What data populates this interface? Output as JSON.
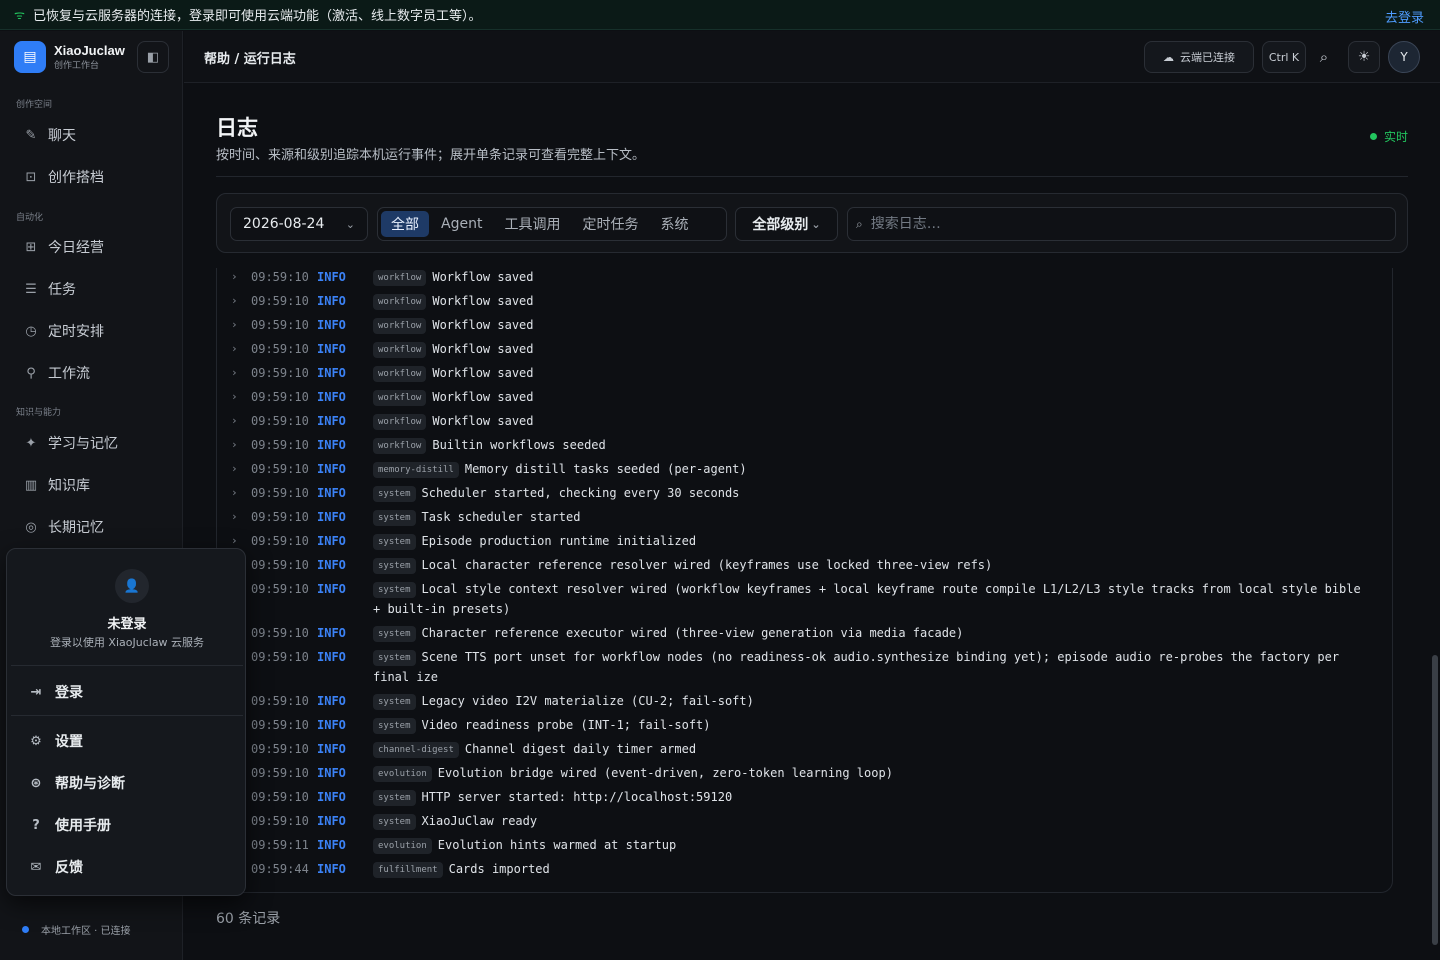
{
  "banner": {
    "text": "已恢复与云服务器的连接，登录即可使用云端功能（激活、线上数字员工等）。",
    "link": "去登录"
  },
  "brand": {
    "name": "XiaoJuclaw",
    "subtitle": "创作工作台"
  },
  "sidebar": {
    "sections": [
      "创作空间",
      "自动化",
      "知识与能力"
    ],
    "items": [
      {
        "label": "聊天",
        "icon": "✎"
      },
      {
        "label": "创作搭档",
        "icon": "⊡"
      },
      {
        "label": "今日经营",
        "icon": "⊞"
      },
      {
        "label": "任务",
        "icon": "☰"
      },
      {
        "label": "定时安排",
        "icon": "◷"
      },
      {
        "label": "工作流",
        "icon": "⚲"
      },
      {
        "label": "学习与记忆",
        "icon": "✦"
      },
      {
        "label": "知识库",
        "icon": "▥"
      },
      {
        "label": "长期记忆",
        "icon": "◎"
      }
    ],
    "status": "本地工作区 · 已连接"
  },
  "topbar": {
    "breadcrumb": "帮助 / 运行日志",
    "cloud": "云端已连接",
    "shortcut": "Ctrl K",
    "avatar": "Y"
  },
  "page": {
    "title": "日志",
    "subtitle": "按时间、来源和级别追踪本机运行事件；展开单条记录可查看完整上下文。",
    "live": "实时",
    "date": "2026-08-24",
    "tabs": [
      "全部",
      "Agent",
      "工具调用",
      "定时任务",
      "系统"
    ],
    "level": "全部级别",
    "search_placeholder": "搜索日志…",
    "count": "60 条记录"
  },
  "logs": [
    {
      "time": "09:59:10",
      "level": "INFO",
      "source": "workflow",
      "msg": "Workflow saved"
    },
    {
      "time": "09:59:10",
      "level": "INFO",
      "source": "workflow",
      "msg": "Workflow saved"
    },
    {
      "time": "09:59:10",
      "level": "INFO",
      "source": "workflow",
      "msg": "Workflow saved"
    },
    {
      "time": "09:59:10",
      "level": "INFO",
      "source": "workflow",
      "msg": "Workflow saved"
    },
    {
      "time": "09:59:10",
      "level": "INFO",
      "source": "workflow",
      "msg": "Workflow saved"
    },
    {
      "time": "09:59:10",
      "level": "INFO",
      "source": "workflow",
      "msg": "Workflow saved"
    },
    {
      "time": "09:59:10",
      "level": "INFO",
      "source": "workflow",
      "msg": "Workflow saved"
    },
    {
      "time": "09:59:10",
      "level": "INFO",
      "source": "workflow",
      "msg": "Builtin workflows seeded"
    },
    {
      "time": "09:59:10",
      "level": "INFO",
      "source": "memory-distill",
      "msg": "Memory distill tasks seeded (per-agent)"
    },
    {
      "time": "09:59:10",
      "level": "INFO",
      "source": "system",
      "msg": "Scheduler started, checking every 30 seconds"
    },
    {
      "time": "09:59:10",
      "level": "INFO",
      "source": "system",
      "msg": "Task scheduler started"
    },
    {
      "time": "09:59:10",
      "level": "INFO",
      "source": "system",
      "msg": "Episode production runtime initialized"
    },
    {
      "time": "09:59:10",
      "level": "INFO",
      "source": "system",
      "msg": "Local character reference resolver wired (keyframes use locked three-view refs)"
    },
    {
      "time": "09:59:10",
      "level": "INFO",
      "source": "system",
      "msg": "Local style context resolver wired (workflow keyframes + local keyframe route compile L1/L2/L3 style tracks from local style bible + built-in presets)"
    },
    {
      "time": "09:59:10",
      "level": "INFO",
      "source": "system",
      "msg": "Character reference executor wired (three-view generation via media facade)"
    },
    {
      "time": "09:59:10",
      "level": "INFO",
      "source": "system",
      "msg": "Scene TTS port unset for workflow nodes (no readiness-ok audio.synthesize binding yet); episode audio re-probes the factory per final ize"
    },
    {
      "time": "09:59:10",
      "level": "INFO",
      "source": "system",
      "msg": "Legacy video I2V materialize (CU-2; fail-soft)"
    },
    {
      "time": "09:59:10",
      "level": "INFO",
      "source": "system",
      "msg": "Video readiness probe (INT-1; fail-soft)"
    },
    {
      "time": "09:59:10",
      "level": "INFO",
      "source": "channel-digest",
      "msg": "Channel digest daily timer armed"
    },
    {
      "time": "09:59:10",
      "level": "INFO",
      "source": "evolution",
      "msg": "Evolution bridge wired (event-driven, zero-token learning loop)"
    },
    {
      "time": "09:59:10",
      "level": "INFO",
      "source": "system",
      "msg": "HTTP server started: http://localhost:59120"
    },
    {
      "time": "09:59:10",
      "level": "INFO",
      "source": "system",
      "msg": "XiaoJuClaw ready"
    },
    {
      "time": "09:59:11",
      "level": "INFO",
      "source": "evolution",
      "msg": "Evolution hints warmed at startup"
    },
    {
      "time": "09:59:44",
      "level": "INFO",
      "source": "fulfillment",
      "msg": "Cards imported"
    }
  ],
  "popup": {
    "name": "未登录",
    "desc": "登录以使用 XiaoJuclaw 云服务",
    "items": [
      {
        "label": "登录",
        "icon": "⇥"
      },
      {
        "label": "设置",
        "icon": "⚙"
      },
      {
        "label": "帮助与诊断",
        "icon": "⊛"
      },
      {
        "label": "使用手册",
        "icon": "?"
      },
      {
        "label": "反馈",
        "icon": "✉"
      }
    ]
  },
  "colors": {
    "accent": "#2f7df6",
    "live": "#22c55e",
    "info": "#3b82f6"
  }
}
